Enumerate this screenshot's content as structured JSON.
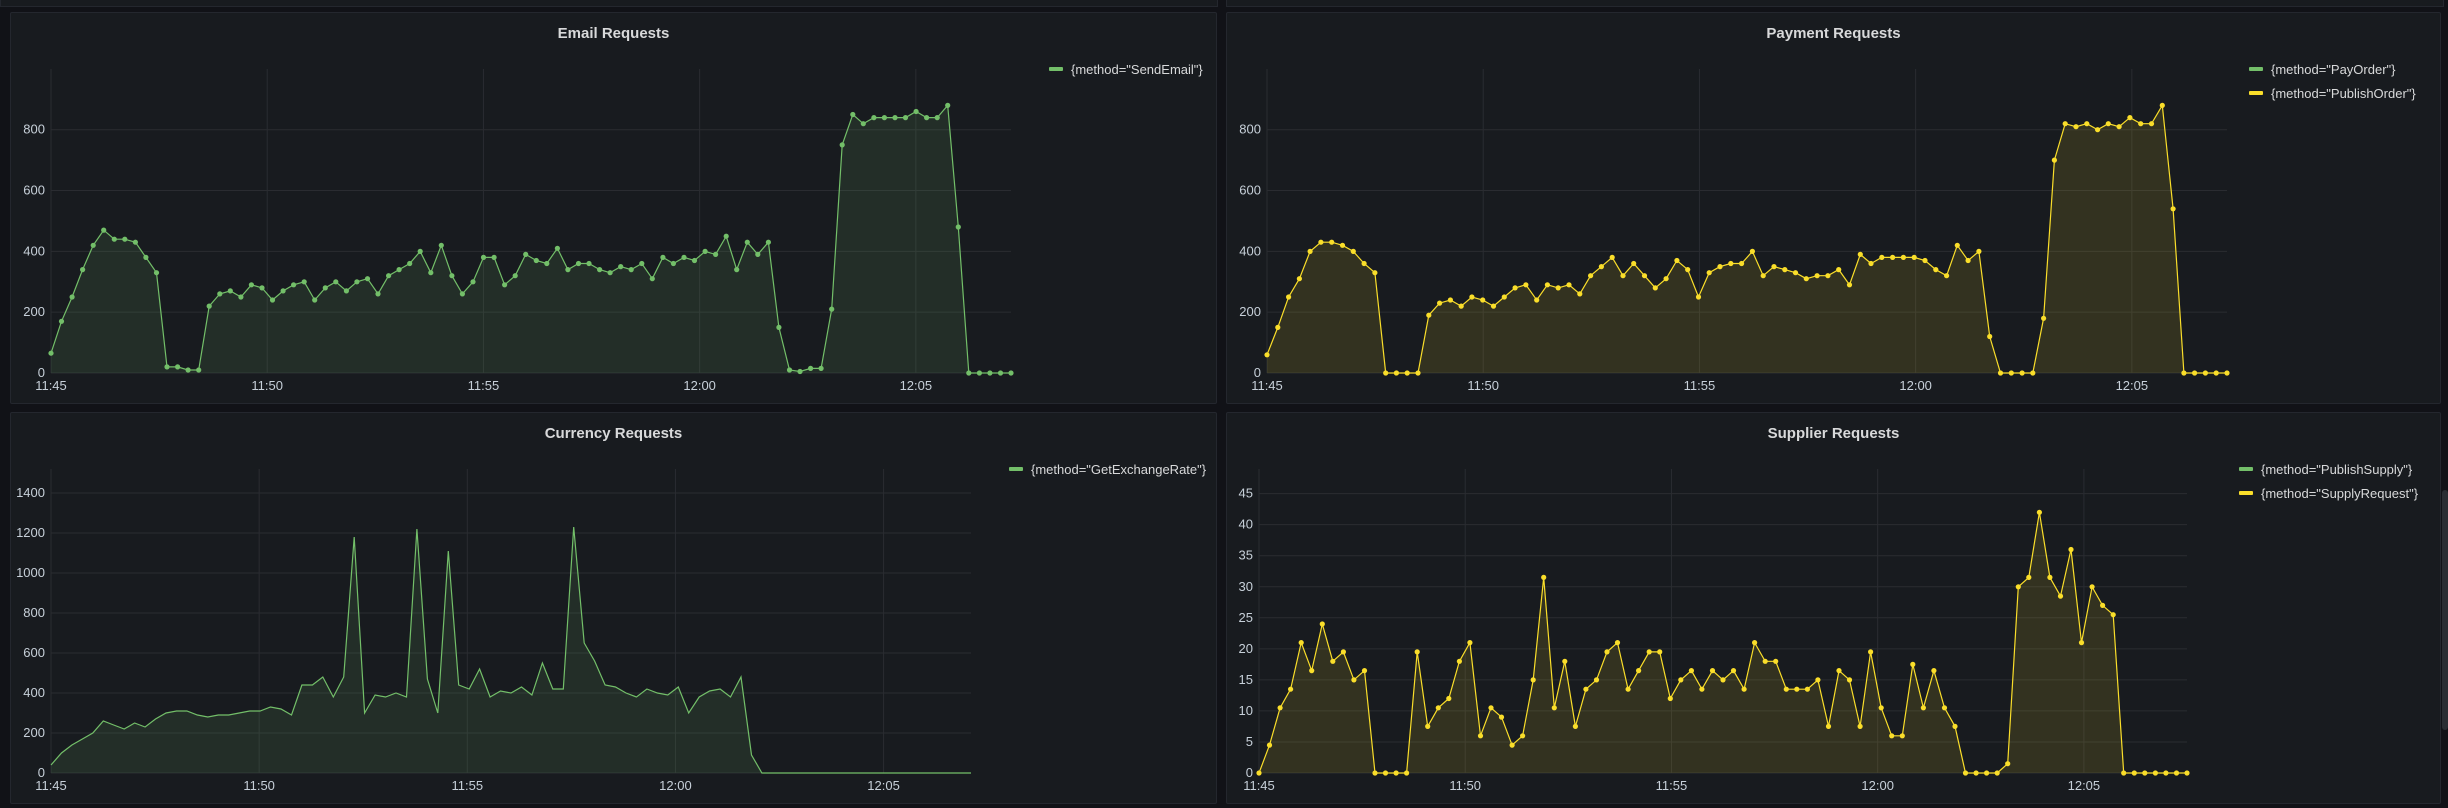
{
  "colors": {
    "green": "#73bf69",
    "yellow": "#fade2a",
    "grid": "#2a2c31",
    "axis_text": "#c7d0d9"
  },
  "panels": [
    {
      "id": "email",
      "title": "Email Requests",
      "legend": [
        {
          "label": "{method=\"SendEmail\"}",
          "color": "#73bf69"
        }
      ],
      "chart_data": {
        "type": "line",
        "title": "Email Requests",
        "x_ticks": [
          "11:45",
          "11:50",
          "11:55",
          "12:00",
          "12:05"
        ],
        "x_tick_values": [
          0,
          5,
          10,
          15,
          20
        ],
        "xlim": [
          0,
          22.2
        ],
        "ylim": [
          0,
          980
        ],
        "y_ticks": [
          0,
          200,
          400,
          600,
          800
        ],
        "points": true,
        "series": [
          {
            "name": "{method=\"SendEmail\"}",
            "color": "#73bf69",
            "values": [
              65,
              170,
              250,
              340,
              420,
              470,
              440,
              440,
              430,
              380,
              330,
              20,
              20,
              10,
              10,
              220,
              260,
              270,
              250,
              290,
              280,
              240,
              270,
              290,
              300,
              240,
              280,
              300,
              270,
              300,
              310,
              260,
              320,
              340,
              360,
              400,
              330,
              420,
              320,
              260,
              300,
              380,
              380,
              290,
              320,
              390,
              370,
              360,
              410,
              340,
              360,
              360,
              340,
              330,
              350,
              340,
              360,
              310,
              380,
              360,
              380,
              370,
              400,
              390,
              450,
              340,
              430,
              390,
              430,
              150,
              10,
              5,
              15,
              15,
              210,
              750,
              850,
              820,
              840,
              840,
              840,
              840,
              860,
              840,
              840,
              880,
              480,
              0,
              0,
              0,
              0,
              0
            ]
          }
        ]
      }
    },
    {
      "id": "payment",
      "title": "Payment Requests",
      "legend": [
        {
          "label": "{method=\"PayOrder\"}",
          "color": "#73bf69"
        },
        {
          "label": "{method=\"PublishOrder\"}",
          "color": "#fade2a"
        }
      ],
      "chart_data": {
        "type": "line",
        "title": "Payment Requests",
        "x_ticks": [
          "11:45",
          "11:50",
          "11:55",
          "12:00",
          "12:05"
        ],
        "x_tick_values": [
          0,
          5,
          10,
          15,
          20
        ],
        "xlim": [
          0,
          22.2
        ],
        "ylim": [
          0,
          980
        ],
        "y_ticks": [
          0,
          200,
          400,
          600,
          800
        ],
        "points": true,
        "series": [
          {
            "name": "{method=\"PublishOrder\"}",
            "color": "#fade2a",
            "values": [
              60,
              150,
              250,
              310,
              400,
              430,
              430,
              420,
              400,
              360,
              330,
              0,
              0,
              0,
              0,
              190,
              230,
              240,
              220,
              250,
              240,
              220,
              250,
              280,
              290,
              240,
              290,
              280,
              290,
              260,
              320,
              350,
              380,
              320,
              360,
              320,
              280,
              310,
              370,
              340,
              250,
              330,
              350,
              360,
              360,
              400,
              320,
              350,
              340,
              330,
              310,
              320,
              320,
              340,
              290,
              390,
              360,
              380,
              380,
              380,
              380,
              370,
              340,
              320,
              420,
              370,
              400,
              120,
              0,
              0,
              0,
              0,
              180,
              700,
              820,
              810,
              820,
              800,
              820,
              810,
              840,
              820,
              820,
              880,
              540,
              0,
              0,
              0,
              0,
              0
            ]
          }
        ]
      }
    },
    {
      "id": "currency",
      "title": "Currency Requests",
      "legend": [
        {
          "label": "{method=\"GetExchangeRate\"}",
          "color": "#73bf69"
        }
      ],
      "chart_data": {
        "type": "area",
        "title": "Currency Requests",
        "x_ticks": [
          "11:45",
          "11:50",
          "11:55",
          "12:00",
          "12:05"
        ],
        "x_tick_values": [
          0,
          5,
          10,
          15,
          20
        ],
        "xlim": [
          0,
          22.1
        ],
        "ylim": [
          0,
          1490
        ],
        "y_ticks": [
          0,
          200,
          400,
          600,
          800,
          1000,
          1200,
          1400
        ],
        "points": false,
        "series": [
          {
            "name": "{method=\"GetExchangeRate\"}",
            "color": "#73bf69",
            "values": [
              40,
              100,
              140,
              170,
              200,
              260,
              240,
              220,
              250,
              230,
              270,
              300,
              310,
              310,
              290,
              280,
              290,
              290,
              300,
              310,
              310,
              330,
              320,
              290,
              440,
              440,
              480,
              380,
              480,
              1180,
              300,
              390,
              380,
              400,
              380,
              1220,
              470,
              300,
              1110,
              440,
              420,
              520,
              380,
              410,
              400,
              430,
              390,
              550,
              420,
              420,
              1230,
              650,
              560,
              440,
              430,
              400,
              380,
              420,
              400,
              390,
              430,
              300,
              380,
              410,
              420,
              380,
              480,
              90,
              0,
              0,
              0,
              0,
              0,
              0,
              0,
              0,
              0,
              0,
              0,
              0,
              0,
              0,
              0,
              0,
              0,
              0,
              0,
              0,
              0
            ]
          }
        ]
      }
    },
    {
      "id": "supplier",
      "title": "Supplier Requests",
      "legend": [
        {
          "label": "{method=\"PublishSupply\"}",
          "color": "#73bf69"
        },
        {
          "label": "{method=\"SupplyRequest\"}",
          "color": "#fade2a"
        }
      ],
      "chart_data": {
        "type": "line",
        "title": "Supplier Requests",
        "x_ticks": [
          "11:45",
          "11:50",
          "11:55",
          "12:00",
          "12:05"
        ],
        "x_tick_values": [
          0,
          5,
          10,
          15,
          20
        ],
        "xlim": [
          0,
          22.5
        ],
        "ylim": [
          0,
          48
        ],
        "y_ticks": [
          0,
          5,
          10,
          15,
          20,
          25,
          30,
          35,
          40,
          45
        ],
        "points": true,
        "series": [
          {
            "name": "{method=\"SupplyRequest\"}",
            "color": "#fade2a",
            "values": [
              0,
              4.5,
              10.5,
              13.5,
              21,
              16.5,
              24,
              18,
              19.5,
              15,
              16.5,
              0,
              0,
              0,
              0,
              19.5,
              7.5,
              10.5,
              12,
              18,
              21,
              6,
              10.5,
              9,
              4.5,
              6,
              15,
              31.5,
              10.5,
              18,
              7.5,
              13.5,
              15,
              19.5,
              21,
              13.5,
              16.5,
              19.5,
              19.5,
              12,
              15,
              16.5,
              13.5,
              16.5,
              15,
              16.5,
              13.5,
              21,
              18,
              18,
              13.5,
              13.5,
              13.5,
              15,
              7.5,
              16.5,
              15,
              7.5,
              19.5,
              10.5,
              6,
              6,
              17.5,
              10.5,
              16.5,
              10.5,
              7.5,
              0,
              0,
              0,
              0,
              1.5,
              30,
              31.5,
              42,
              31.5,
              28.5,
              36,
              21,
              30,
              27,
              25.5,
              0,
              0,
              0,
              0,
              0,
              0,
              0
            ]
          }
        ]
      }
    }
  ]
}
